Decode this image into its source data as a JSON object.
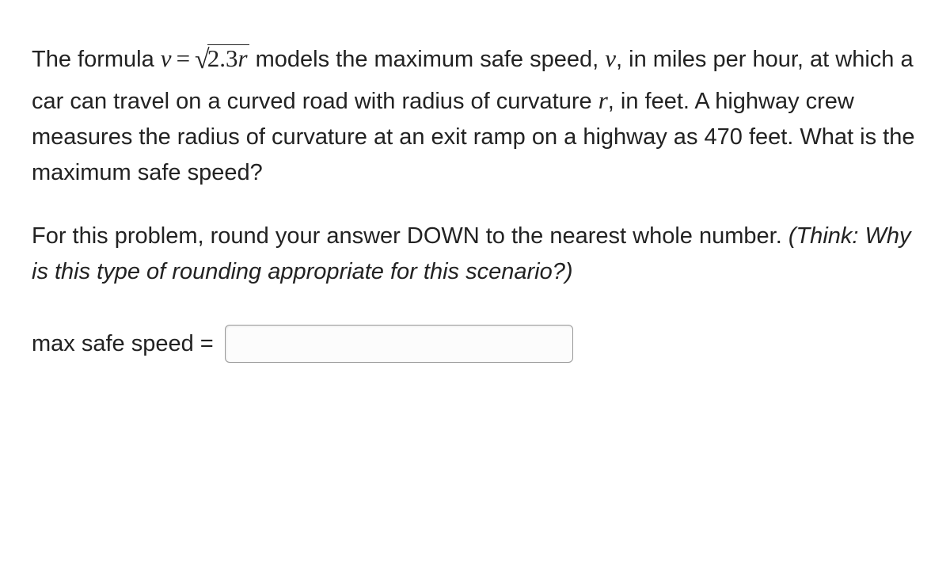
{
  "problem": {
    "line1_pre": "The formula ",
    "var_v": "v",
    "eq": "=",
    "sqrt_coef": "2.3",
    "sqrt_var": "r",
    "line1_post": " models the maximum safe speed, ",
    "var_v2": "v",
    "line1_end": ", in miles per hour, at which a car can travel on a curved road with radius of curvature ",
    "var_r": "r",
    "line1_tail": ", in feet. A highway crew measures the radius of curvature at an exit ramp on a highway as 470 feet. What is the maximum safe speed?"
  },
  "instruction": {
    "pre": "For this problem, round your answer DOWN to the nearest whole number. ",
    "italic": "(Think: Why is this type of rounding appropriate for this scenario?)"
  },
  "answer": {
    "label": "max safe speed =",
    "value": ""
  }
}
